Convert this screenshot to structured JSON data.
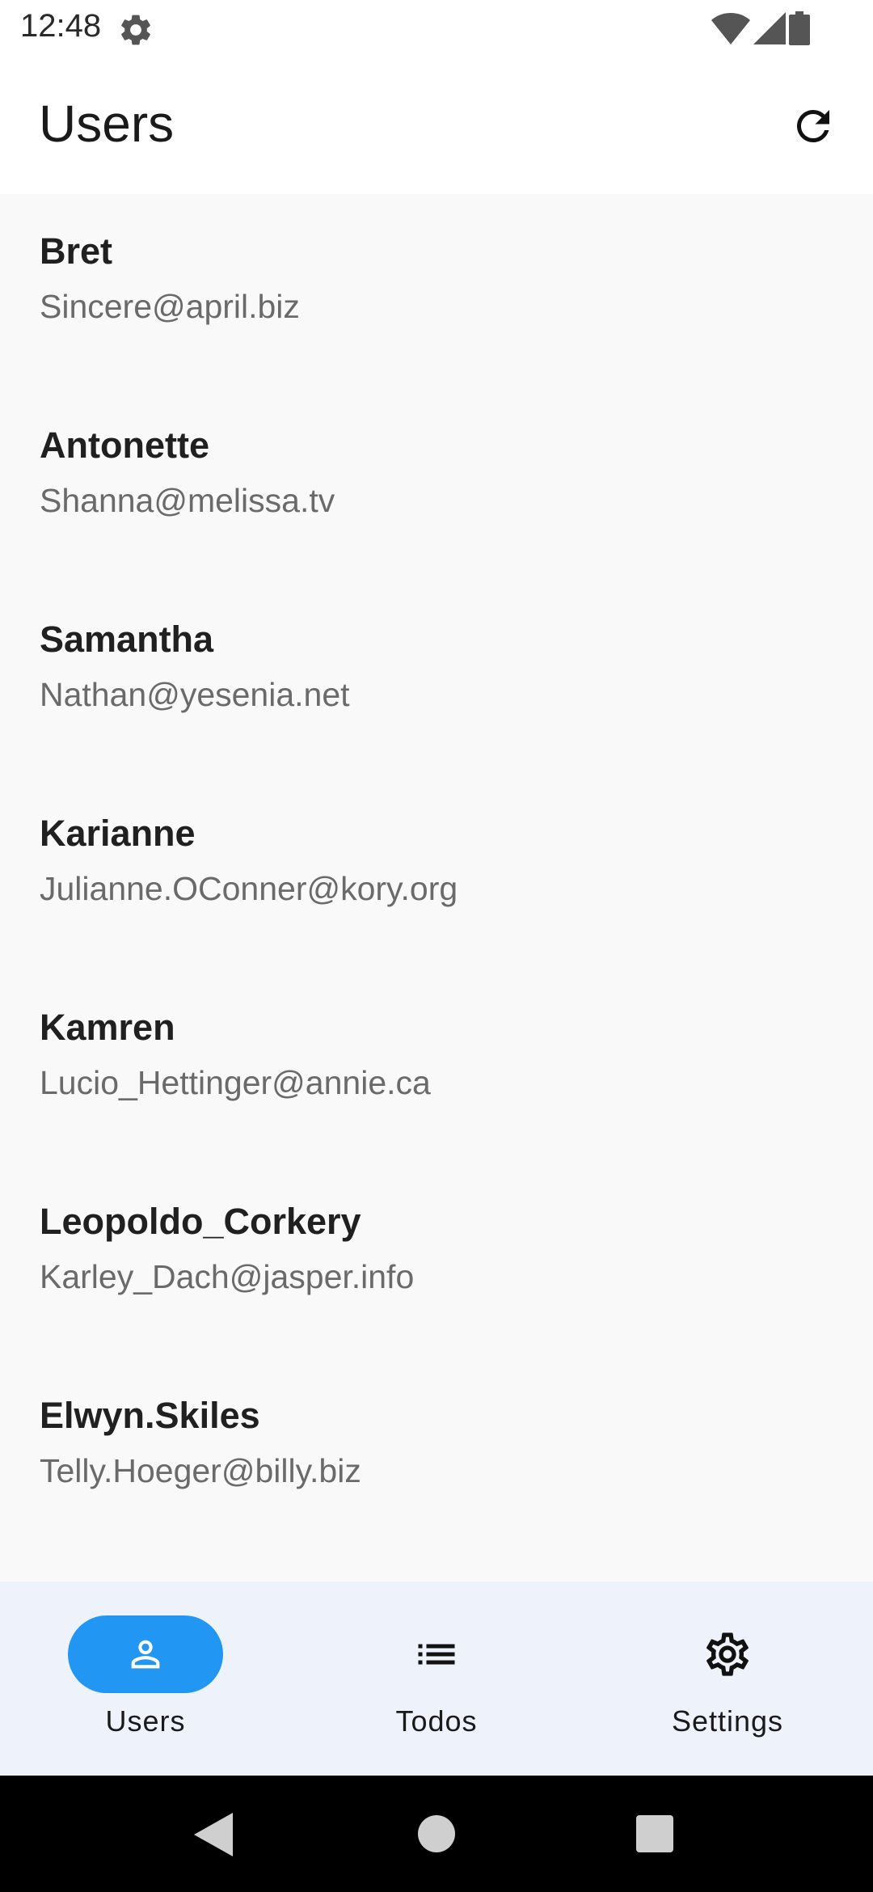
{
  "status_bar": {
    "time": "12:48",
    "icons": [
      "settings-gear-icon",
      "wifi-icon",
      "cellular-signal-icon",
      "battery-icon"
    ]
  },
  "app_bar": {
    "title": "Users",
    "action_icon": "refresh-icon"
  },
  "users": [
    {
      "name": "Bret",
      "email": "Sincere@april.biz"
    },
    {
      "name": "Antonette",
      "email": "Shanna@melissa.tv"
    },
    {
      "name": "Samantha",
      "email": "Nathan@yesenia.net"
    },
    {
      "name": "Karianne",
      "email": "Julianne.OConner@kory.org"
    },
    {
      "name": "Kamren",
      "email": "Lucio_Hettinger@annie.ca"
    },
    {
      "name": "Leopoldo_Corkery",
      "email": "Karley_Dach@jasper.info"
    },
    {
      "name": "Elwyn.Skiles",
      "email": "Telly.Hoeger@billy.biz"
    }
  ],
  "bottom_nav": {
    "items": [
      {
        "label": "Users",
        "icon": "person-icon",
        "active": true
      },
      {
        "label": "Todos",
        "icon": "list-icon",
        "active": false
      },
      {
        "label": "Settings",
        "icon": "gear-icon",
        "active": false
      }
    ]
  },
  "colors": {
    "accent": "#2196f3",
    "list_background": "#f9f9f9",
    "nav_background": "#edf2fb"
  },
  "system_nav": {
    "buttons": [
      "back-icon",
      "home-icon",
      "recents-icon"
    ]
  }
}
